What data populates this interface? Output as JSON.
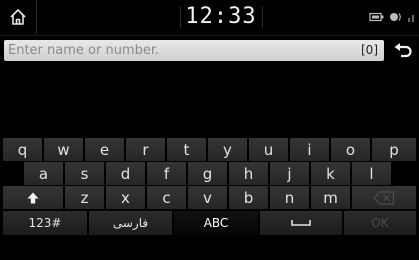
{
  "status_bar": {
    "time": "12:33",
    "icons": [
      "home-icon",
      "battery-icon",
      "bluetooth-icon",
      "signal-icon"
    ]
  },
  "input": {
    "placeholder": "Enter name or number.",
    "count": "[0]",
    "back_icon": "back-arrow-icon"
  },
  "keyboard": {
    "row1": [
      "q",
      "w",
      "e",
      "r",
      "t",
      "y",
      "u",
      "i",
      "o",
      "p"
    ],
    "row2": [
      "a",
      "s",
      "d",
      "f",
      "g",
      "h",
      "j",
      "k",
      "l"
    ],
    "row3": [
      "z",
      "x",
      "c",
      "v",
      "b",
      "n",
      "m"
    ],
    "shift_icon": "shift-arrow-icon",
    "backspace_icon": "backspace-icon",
    "space_icon": "space-icon",
    "mode_numbers": "123#",
    "mode_farsi": "فارسی",
    "mode_abc": "ABC",
    "ok": "OK",
    "active_mode": "ABC"
  }
}
